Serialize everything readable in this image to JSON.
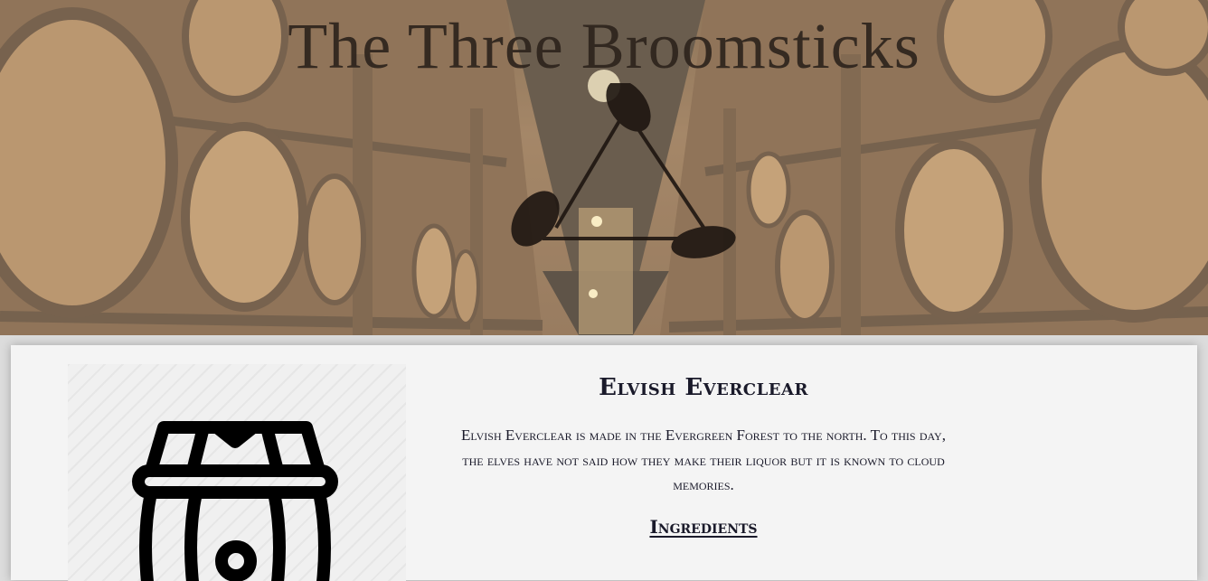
{
  "site": {
    "title": "The Three Broomsticks"
  },
  "hero": {
    "background": "barrel-cellar-photo",
    "logo_icon": "crossed-broomsticks-triangle-icon"
  },
  "product": {
    "name": "Elvish Everclear",
    "description": "Elvish Everclear is made in the Evergreen Forest to the north. To this day, the elves have not said how they make their liquor but it is known to cloud memories.",
    "ingredients_heading": "Ingredients",
    "image_icon": "barrel-icon"
  },
  "colors": {
    "text_dark": "#1a1a2a",
    "card_bg": "#f4f4f4",
    "page_bg": "#dcdcdc"
  }
}
